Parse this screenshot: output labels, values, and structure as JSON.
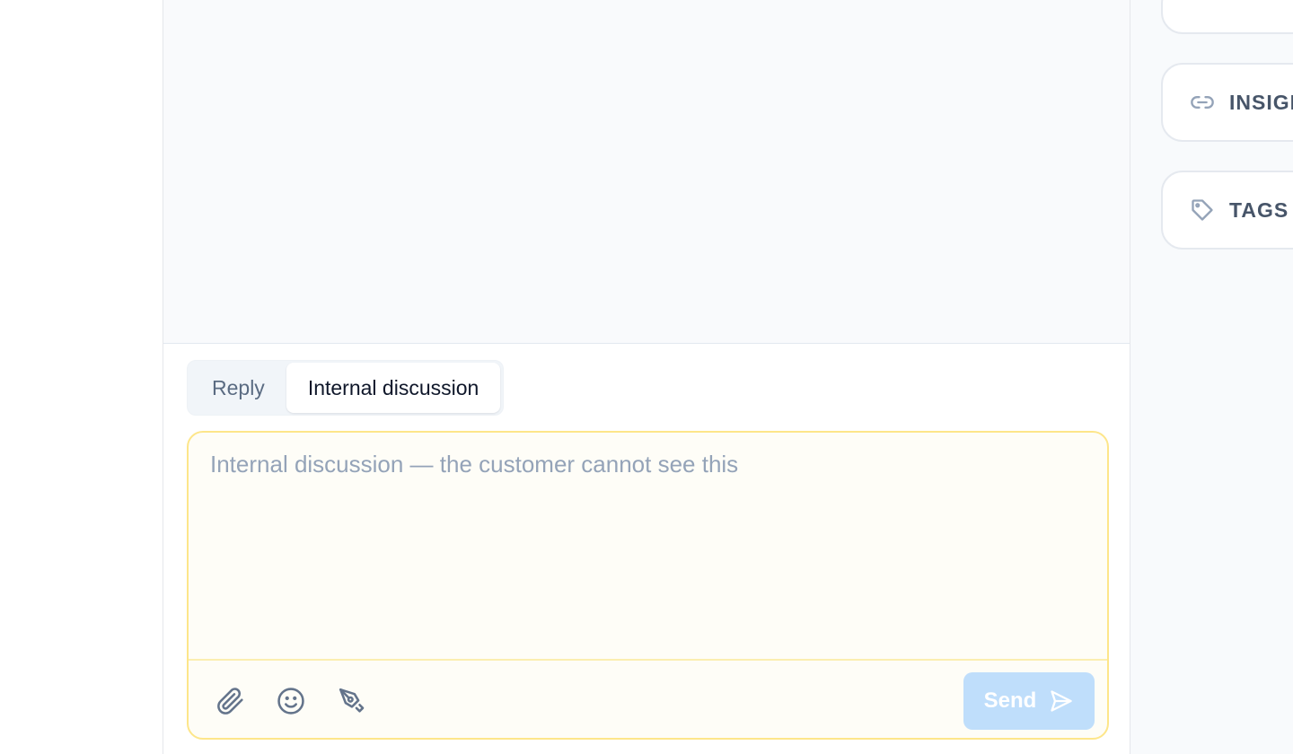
{
  "composer": {
    "tabs": [
      {
        "label": "Reply",
        "active": false
      },
      {
        "label": "Internal discussion",
        "active": true
      }
    ],
    "placeholder": "Internal discussion — the customer cannot see this",
    "value": "",
    "send_label": "Send",
    "tools": [
      "paperclip-icon",
      "emoji-icon",
      "signature-pen-icon"
    ],
    "accent_border": "#fde68a",
    "send_color": "#bfdefb"
  },
  "sidebar": {
    "cards": [
      {
        "label": "",
        "icon": ""
      },
      {
        "label": "INSIGHTS",
        "icon": "link-icon"
      },
      {
        "label": "TAGS",
        "icon": "tag-icon"
      }
    ]
  }
}
